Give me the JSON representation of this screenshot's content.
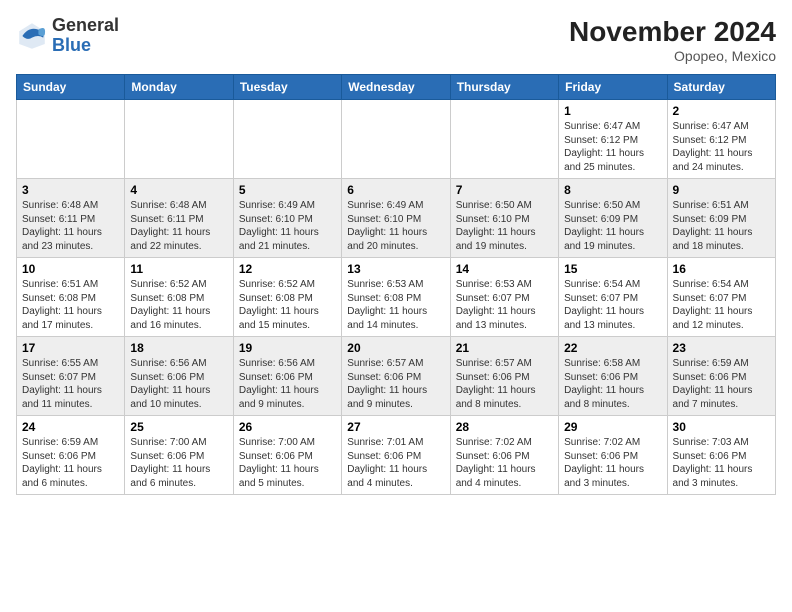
{
  "logo": {
    "general": "General",
    "blue": "Blue"
  },
  "title": "November 2024",
  "subtitle": "Opopeo, Mexico",
  "weekdays": [
    "Sunday",
    "Monday",
    "Tuesday",
    "Wednesday",
    "Thursday",
    "Friday",
    "Saturday"
  ],
  "weeks": [
    [
      {
        "day": "",
        "info": ""
      },
      {
        "day": "",
        "info": ""
      },
      {
        "day": "",
        "info": ""
      },
      {
        "day": "",
        "info": ""
      },
      {
        "day": "",
        "info": ""
      },
      {
        "day": "1",
        "info": "Sunrise: 6:47 AM\nSunset: 6:12 PM\nDaylight: 11 hours and 25 minutes."
      },
      {
        "day": "2",
        "info": "Sunrise: 6:47 AM\nSunset: 6:12 PM\nDaylight: 11 hours and 24 minutes."
      }
    ],
    [
      {
        "day": "3",
        "info": "Sunrise: 6:48 AM\nSunset: 6:11 PM\nDaylight: 11 hours and 23 minutes."
      },
      {
        "day": "4",
        "info": "Sunrise: 6:48 AM\nSunset: 6:11 PM\nDaylight: 11 hours and 22 minutes."
      },
      {
        "day": "5",
        "info": "Sunrise: 6:49 AM\nSunset: 6:10 PM\nDaylight: 11 hours and 21 minutes."
      },
      {
        "day": "6",
        "info": "Sunrise: 6:49 AM\nSunset: 6:10 PM\nDaylight: 11 hours and 20 minutes."
      },
      {
        "day": "7",
        "info": "Sunrise: 6:50 AM\nSunset: 6:10 PM\nDaylight: 11 hours and 19 minutes."
      },
      {
        "day": "8",
        "info": "Sunrise: 6:50 AM\nSunset: 6:09 PM\nDaylight: 11 hours and 19 minutes."
      },
      {
        "day": "9",
        "info": "Sunrise: 6:51 AM\nSunset: 6:09 PM\nDaylight: 11 hours and 18 minutes."
      }
    ],
    [
      {
        "day": "10",
        "info": "Sunrise: 6:51 AM\nSunset: 6:08 PM\nDaylight: 11 hours and 17 minutes."
      },
      {
        "day": "11",
        "info": "Sunrise: 6:52 AM\nSunset: 6:08 PM\nDaylight: 11 hours and 16 minutes."
      },
      {
        "day": "12",
        "info": "Sunrise: 6:52 AM\nSunset: 6:08 PM\nDaylight: 11 hours and 15 minutes."
      },
      {
        "day": "13",
        "info": "Sunrise: 6:53 AM\nSunset: 6:08 PM\nDaylight: 11 hours and 14 minutes."
      },
      {
        "day": "14",
        "info": "Sunrise: 6:53 AM\nSunset: 6:07 PM\nDaylight: 11 hours and 13 minutes."
      },
      {
        "day": "15",
        "info": "Sunrise: 6:54 AM\nSunset: 6:07 PM\nDaylight: 11 hours and 13 minutes."
      },
      {
        "day": "16",
        "info": "Sunrise: 6:54 AM\nSunset: 6:07 PM\nDaylight: 11 hours and 12 minutes."
      }
    ],
    [
      {
        "day": "17",
        "info": "Sunrise: 6:55 AM\nSunset: 6:07 PM\nDaylight: 11 hours and 11 minutes."
      },
      {
        "day": "18",
        "info": "Sunrise: 6:56 AM\nSunset: 6:06 PM\nDaylight: 11 hours and 10 minutes."
      },
      {
        "day": "19",
        "info": "Sunrise: 6:56 AM\nSunset: 6:06 PM\nDaylight: 11 hours and 9 minutes."
      },
      {
        "day": "20",
        "info": "Sunrise: 6:57 AM\nSunset: 6:06 PM\nDaylight: 11 hours and 9 minutes."
      },
      {
        "day": "21",
        "info": "Sunrise: 6:57 AM\nSunset: 6:06 PM\nDaylight: 11 hours and 8 minutes."
      },
      {
        "day": "22",
        "info": "Sunrise: 6:58 AM\nSunset: 6:06 PM\nDaylight: 11 hours and 8 minutes."
      },
      {
        "day": "23",
        "info": "Sunrise: 6:59 AM\nSunset: 6:06 PM\nDaylight: 11 hours and 7 minutes."
      }
    ],
    [
      {
        "day": "24",
        "info": "Sunrise: 6:59 AM\nSunset: 6:06 PM\nDaylight: 11 hours and 6 minutes."
      },
      {
        "day": "25",
        "info": "Sunrise: 7:00 AM\nSunset: 6:06 PM\nDaylight: 11 hours and 6 minutes."
      },
      {
        "day": "26",
        "info": "Sunrise: 7:00 AM\nSunset: 6:06 PM\nDaylight: 11 hours and 5 minutes."
      },
      {
        "day": "27",
        "info": "Sunrise: 7:01 AM\nSunset: 6:06 PM\nDaylight: 11 hours and 4 minutes."
      },
      {
        "day": "28",
        "info": "Sunrise: 7:02 AM\nSunset: 6:06 PM\nDaylight: 11 hours and 4 minutes."
      },
      {
        "day": "29",
        "info": "Sunrise: 7:02 AM\nSunset: 6:06 PM\nDaylight: 11 hours and 3 minutes."
      },
      {
        "day": "30",
        "info": "Sunrise: 7:03 AM\nSunset: 6:06 PM\nDaylight: 11 hours and 3 minutes."
      }
    ]
  ]
}
